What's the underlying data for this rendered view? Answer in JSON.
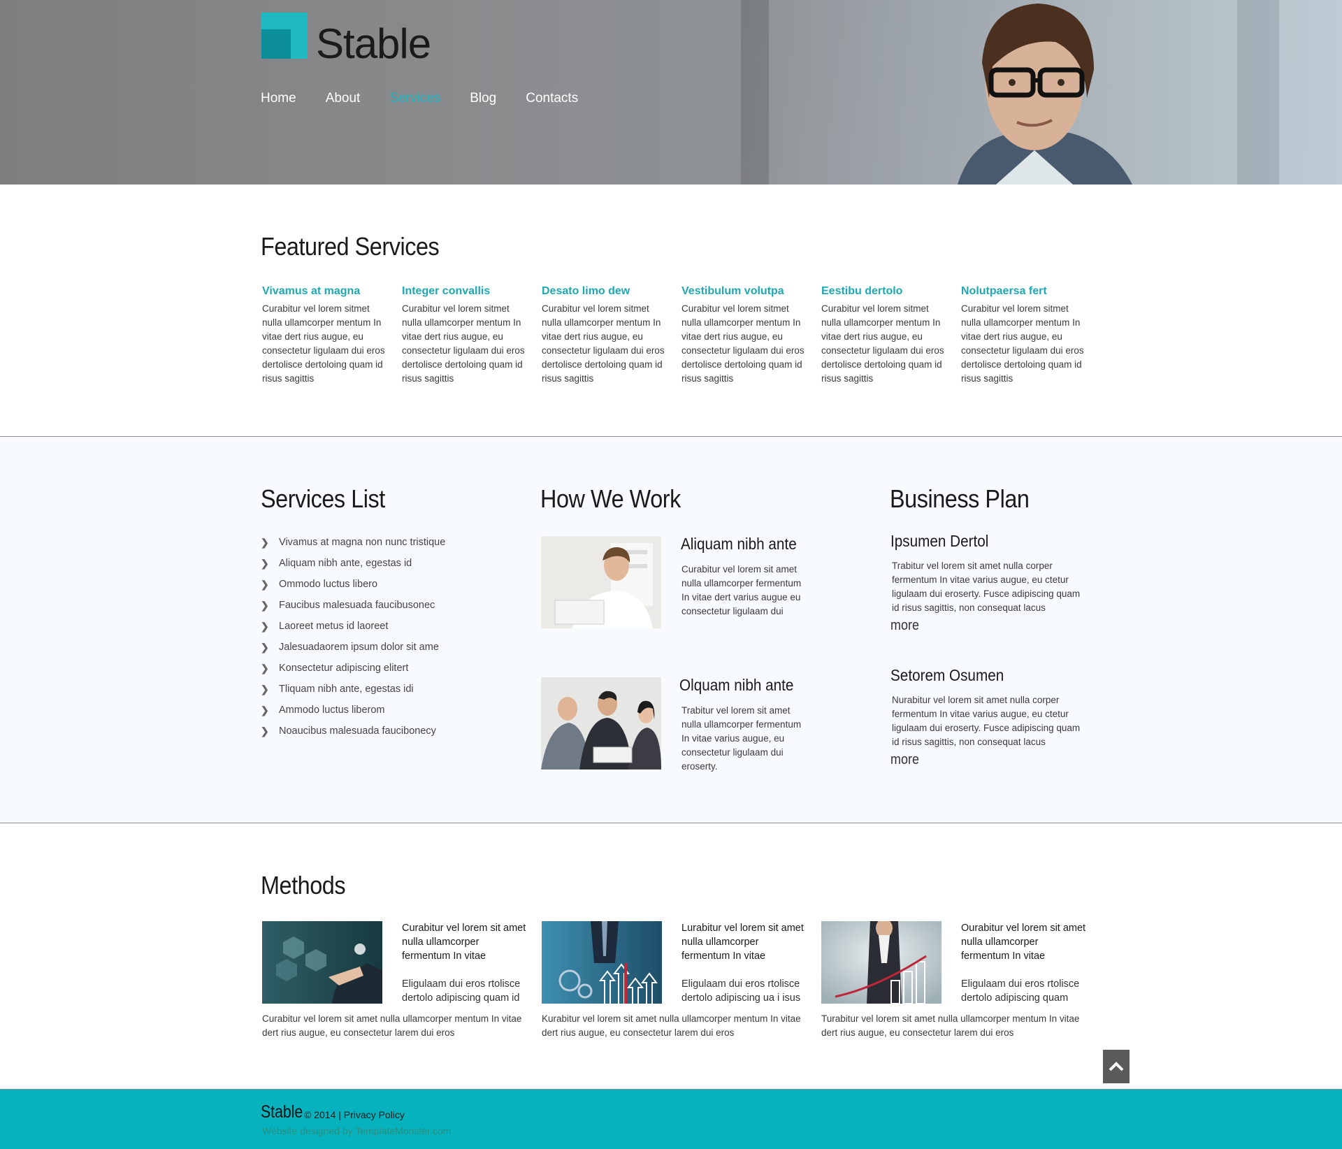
{
  "header": {
    "brand": "Stable",
    "nav": [
      "Home",
      "About",
      "Services",
      "Blog",
      "Contacts"
    ],
    "active_nav": "Services"
  },
  "featured": {
    "title": "Featured Services",
    "items": [
      {
        "title": "Vivamus at magna",
        "text": "Curabitur vel lorem sitmet nulla ullamcorper mentum In vitae dert rius augue, eu consectetur ligulaam dui eros dertolisce dertoloing quam id risus sagittis"
      },
      {
        "title": "Integer convallis",
        "text": "Curabitur vel lorem sitmet nulla ullamcorper mentum In vitae dert rius augue, eu consectetur ligulaam dui eros dertolisce dertoloing quam id risus sagittis"
      },
      {
        "title": "Desato limo dew",
        "text": "Curabitur vel lorem sitmet nulla ullamcorper mentum In vitae dert rius augue, eu consectetur ligulaam dui eros dertolisce dertoloing quam id risus sagittis"
      },
      {
        "title": "Vestibulum volutpa",
        "text": "Curabitur vel lorem sitmet nulla ullamcorper mentum In vitae dert rius augue, eu consectetur ligulaam dui eros dertolisce dertoloing quam id risus sagittis"
      },
      {
        "title": "Eestibu dertolo",
        "text": "Curabitur vel lorem sitmet nulla ullamcorper mentum In vitae dert rius augue, eu consectetur ligulaam dui eros dertolisce dertoloing quam id risus sagittis"
      },
      {
        "title": "Nolutpaersa fert",
        "text": "Curabitur vel lorem sitmet nulla ullamcorper mentum In vitae dert rius augue, eu consectetur ligulaam dui eros dertolisce dertoloing quam id risus sagittis"
      }
    ]
  },
  "services_list": {
    "title": "Services List",
    "items": [
      "Vivamus at magna non nunc tristique",
      "Aliquam nibh ante, egestas id",
      "Ommodo luctus libero",
      "Faucibus malesuada faucibusonec",
      "Laoreet metus id laoreet",
      "Jalesuadaorem ipsum dolor sit ame",
      "Konsectetur adipiscing elitert",
      "Tliquam nibh ante, egestas idi",
      "Ammodo luctus liberom",
      "Noaucibus malesuada faucibonecy"
    ]
  },
  "how_we_work": {
    "title": "How We Work",
    "items": [
      {
        "title": "Aliquam nibh ante",
        "text": "Curabitur vel lorem sit amet nulla ullamcorper fermentum In vitae dert varius augue eu consectetur ligulaam dui"
      },
      {
        "title": "Olquam nibh ante",
        "text": "Trabitur vel lorem sit amet nulla ullamcorper fermentum In vitae varius augue, eu consectetur ligulaam dui eroserty."
      }
    ]
  },
  "business_plan": {
    "title": "Business Plan",
    "items": [
      {
        "title": "Ipsumen Dertol",
        "text": "Trabitur vel lorem sit amet nulla corper fermentum In vitae varius augue, eu ctetur ligulaam dui eroserty. Fusce adipiscing quam id risus sagittis, non consequat lacus",
        "more": "more"
      },
      {
        "title": "Setorem Osumen",
        "text": "Nurabitur vel lorem sit amet nulla corper fermentum In vitae varius augue, eu ctetur ligulaam dui eroserty. Fusce adipiscing quam id risus sagittis, non consequat lacus",
        "more": "more"
      }
    ]
  },
  "methods": {
    "title": "Methods",
    "items": [
      {
        "lead": "Curabitur vel lorem sit amet nulla ullamcorper fermentum In vitae",
        "sub": "Eligulaam dui eros rtolisce dertolo adipiscing quam id",
        "bottom": "Curabitur vel lorem sit amet nulla ullamcorper mentum In vitae dert rius augue, eu consectetur larem dui eros"
      },
      {
        "lead": "Lurabitur vel lorem sit amet nulla ullamcorper fermentum In vitae",
        "sub": "Eligulaam dui eros rtolisce dertolo adipiscing ua i isus",
        "bottom": "Kurabitur vel lorem sit amet nulla ullamcorper mentum In vitae dert rius augue, eu consectetur larem dui eros"
      },
      {
        "lead": "Ourabitur vel lorem sit amet nulla ullamcorper fermentum In vitae",
        "sub": "Eligulaam dui eros rtolisce dertolo adipiscing quam",
        "bottom": "Turabitur vel lorem sit amet nulla ullamcorper mentum In vitae dert rius augue, eu consectetur larem dui eros"
      }
    ]
  },
  "footer": {
    "brand": "Stable",
    "copyright": "© 2014 |",
    "privacy": "Privacy Policy",
    "designed_by": "Website designed by TemplateMonster.com"
  },
  "icons": {
    "list_bullet": "chevron-right-icon",
    "back_to_top": "chevron-up-icon"
  },
  "colors": {
    "accent": "#1fa8b4",
    "footer_bg": "#06b2bd",
    "logo_light": "#1fb9c4",
    "logo_dark": "#0b8e98"
  }
}
